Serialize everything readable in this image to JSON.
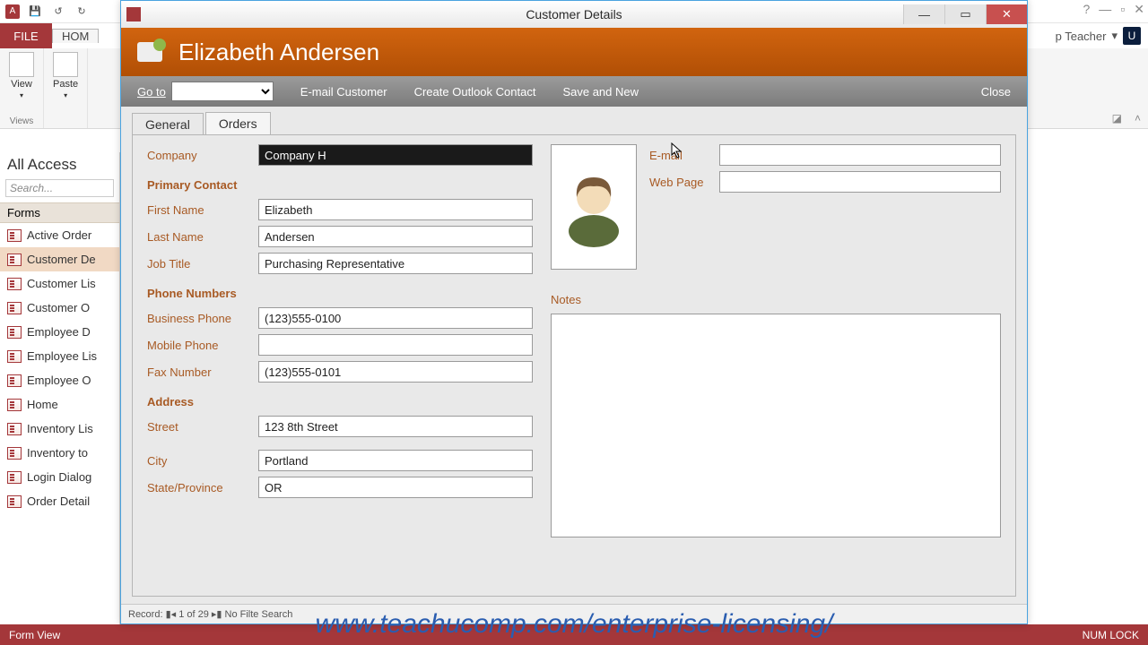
{
  "host": {
    "qat_save": "💾",
    "qat_undo": "↺",
    "qat_redo": "↻",
    "file": "FILE",
    "tab_home": "HOM",
    "teacher": "p Teacher",
    "u": "U",
    "help_q": "?",
    "view_label": "View",
    "paste_label": "Paste",
    "group_views": "Views",
    "nav_title": "All Access",
    "nav_search_ph": "Search...",
    "nav_cat": "Forms",
    "status_left": "Form View",
    "status_right": "NUM LOCK",
    "record_nav": "Record:  ▮◂   1 of 29   ▸▮   No Filte   Search"
  },
  "nav_items": [
    "Active Order",
    "Customer De",
    "Customer Lis",
    "Customer O",
    "Employee D",
    "Employee Lis",
    "Employee O",
    "Home",
    "Inventory Lis",
    "Inventory to",
    "Login Dialog",
    "Order Detail"
  ],
  "win": {
    "title": "Customer Details",
    "min": "—",
    "max": "▭",
    "close": "✕"
  },
  "header": {
    "name": "Elizabeth Andersen",
    "goto": "Go to",
    "email": "E-mail Customer",
    "outlook": "Create Outlook Contact",
    "savenew": "Save and New",
    "close": "Close"
  },
  "tabs": {
    "general": "General",
    "orders": "Orders"
  },
  "labels": {
    "company": "Company",
    "primary": "Primary Contact",
    "first": "First Name",
    "last": "Last Name",
    "job": "Job Title",
    "phones": "Phone Numbers",
    "biz": "Business Phone",
    "mob": "Mobile Phone",
    "fax": "Fax Number",
    "address": "Address",
    "street": "Street",
    "city": "City",
    "state": "State/Province",
    "email": "E-mail",
    "web": "Web Page",
    "notes": "Notes"
  },
  "values": {
    "company": "Company H",
    "first": "Elizabeth",
    "last": "Andersen",
    "job": "Purchasing Representative",
    "biz": "(123)555-0100",
    "mob": "",
    "fax": "(123)555-0101",
    "street": "123 8th Street",
    "city": "Portland",
    "state": "OR",
    "email": "",
    "web": "",
    "notes": ""
  },
  "watermark": "www.teachucomp.com/enterprise-licensing/"
}
